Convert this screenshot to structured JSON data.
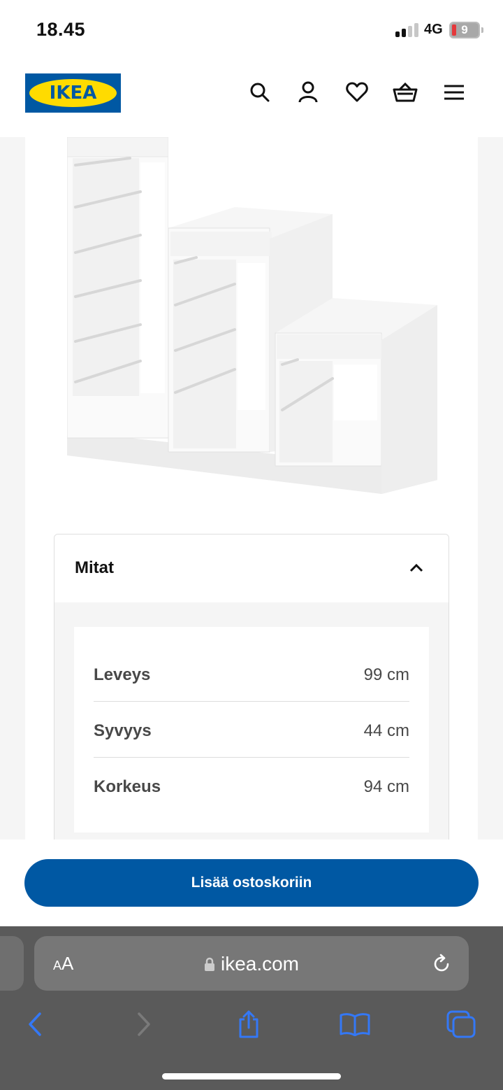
{
  "status_bar": {
    "time": "18.45",
    "network": "4G",
    "battery": "9"
  },
  "header": {
    "logo_text": "IKEA",
    "icons": [
      "search-icon",
      "user-icon",
      "heart-icon",
      "cart-icon",
      "menu-icon"
    ]
  },
  "dimensions": {
    "title": "Mitat",
    "rows": [
      {
        "label": "Leveys",
        "value": "99 cm"
      },
      {
        "label": "Syvyys",
        "value": "44 cm"
      },
      {
        "label": "Korkeus",
        "value": "94 cm"
      }
    ]
  },
  "cart": {
    "button_label": "Lisää ostoskoriin"
  },
  "browser": {
    "aa_small": "A",
    "aa_large": "A",
    "url": "ikea.com",
    "accent": "#3478f6"
  },
  "colors": {
    "brand_blue": "#0058a3",
    "brand_yellow": "#ffdb00"
  }
}
